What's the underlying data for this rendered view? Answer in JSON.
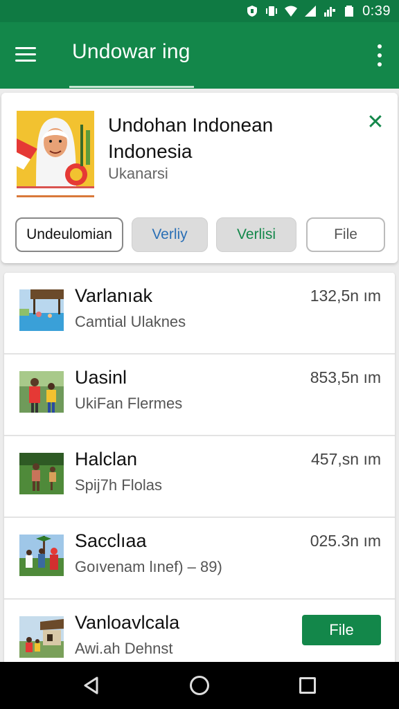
{
  "status_bar": {
    "time": "0:39",
    "icons": [
      "shield-icon",
      "vibrate-icon",
      "wifi-icon",
      "signal-icon",
      "signal-roaming-icon",
      "battery-icon"
    ]
  },
  "app_bar": {
    "title": "Undowar ing",
    "menu_icon": "hamburger-menu-icon",
    "more_icon": "more-vertical-icon"
  },
  "profile": {
    "name": "Undohan Indonean Indonesia",
    "subtitle": "Ukanarsi",
    "close_icon": "close-icon",
    "chips": [
      "Undeulomian",
      "Verliy",
      "Verlisi",
      "File"
    ]
  },
  "list": [
    {
      "title": "Varlanıak",
      "subtitle": "Camtial Ulaknes",
      "distance": "132,5n ım",
      "thumb_icon": "pool-photo"
    },
    {
      "title": "Uasinl",
      "subtitle": "UkiFan Flermes",
      "distance": "853,5n ım",
      "thumb_icon": "people-photo"
    },
    {
      "title": "Halclan",
      "subtitle": "Spij7h Flolas",
      "distance": "457,sn ım",
      "thumb_icon": "field-photo"
    },
    {
      "title": "Sacclıaa",
      "subtitle": "Goıvenam lınef) – 89)",
      "distance": "025.3n ım",
      "thumb_icon": "group-photo"
    },
    {
      "title": "Vanloavlcala",
      "subtitle": "Awi.ah Dehnst",
      "button": "File",
      "thumb_icon": "house-photo"
    }
  ],
  "colors": {
    "primary": "#13874a",
    "status_bar": "#0f7a43",
    "accent_blue": "#2a6fb5"
  },
  "nav_bar": {
    "icons": [
      "back-icon",
      "home-icon",
      "recents-icon"
    ]
  }
}
